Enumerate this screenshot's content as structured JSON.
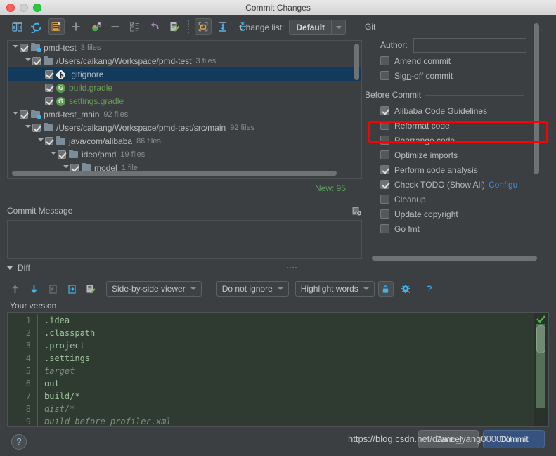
{
  "window": {
    "title": "Commit Changes"
  },
  "toolbar": {
    "icons": [
      {
        "name": "refresh-changes-icon"
      },
      {
        "name": "rollback-icon"
      },
      {
        "name": "delete-changelist-icon"
      },
      {
        "name": "add-icon"
      },
      {
        "name": "move-to-changelist-icon"
      },
      {
        "name": "minus-icon"
      },
      {
        "name": "select-all-icon"
      },
      {
        "name": "revert-icon"
      },
      {
        "name": "edit-source-icon"
      },
      {
        "name": "group-by-directory-icon"
      },
      {
        "name": "expand-all-icon"
      },
      {
        "name": "collapse-all-icon"
      }
    ],
    "changelist_label": "Change list:",
    "changelist_value": "Default"
  },
  "tree": {
    "rows": [
      {
        "indent": 0,
        "twisty": "open",
        "checked": true,
        "icon": "folder-modified-icon",
        "name": "pmd-test",
        "count": "3 files",
        "selected": false,
        "green": false
      },
      {
        "indent": 1,
        "twisty": "open",
        "checked": true,
        "icon": "folder-icon",
        "name": "/Users/caikang/Workspace/pmd-test",
        "count": "3 files",
        "selected": false,
        "green": false
      },
      {
        "indent": 2,
        "twisty": "none",
        "checked": true,
        "icon": "git-file-icon",
        "name": ".gitignore",
        "count": "",
        "selected": true,
        "green": false
      },
      {
        "indent": 2,
        "twisty": "none",
        "checked": true,
        "icon": "gradle-icon",
        "name": "build.gradle",
        "count": "",
        "selected": false,
        "green": true
      },
      {
        "indent": 2,
        "twisty": "none",
        "checked": true,
        "icon": "gradle-icon",
        "name": "settings.gradle",
        "count": "",
        "selected": false,
        "green": true
      },
      {
        "indent": 0,
        "twisty": "open",
        "checked": true,
        "icon": "folder-modified-icon",
        "name": "pmd-test_main",
        "count": "92 files",
        "selected": false,
        "green": false
      },
      {
        "indent": 1,
        "twisty": "open",
        "checked": true,
        "icon": "folder-icon",
        "name": "/Users/caikang/Workspace/pmd-test/src/main",
        "count": "92 files",
        "selected": false,
        "green": false
      },
      {
        "indent": 2,
        "twisty": "open",
        "checked": true,
        "icon": "folder-icon",
        "name": "java/com/alibaba",
        "count": "86 files",
        "selected": false,
        "green": false
      },
      {
        "indent": 3,
        "twisty": "open",
        "checked": true,
        "icon": "folder-icon",
        "name": "idea/pmd",
        "count": "19 files",
        "selected": false,
        "green": false
      },
      {
        "indent": 4,
        "twisty": "open",
        "checked": true,
        "icon": "folder-icon",
        "name": "model",
        "count": "1 file",
        "selected": false,
        "green": false
      }
    ],
    "new_count": "New: 95"
  },
  "commit_message": {
    "title": "Commit Message",
    "value": "",
    "history_icon": "commit-history-icon"
  },
  "git": {
    "section_title": "Git",
    "author_label": "Author:",
    "author_value": "",
    "options": [
      {
        "label": "Amend commit",
        "checked": false,
        "mnemonic_index": 1
      },
      {
        "label": "Sign-off commit",
        "checked": false,
        "mnemonic_index": 3
      }
    ]
  },
  "before_commit": {
    "section_title": "Before Commit",
    "options": [
      {
        "label": "Alibaba Code Guidelines",
        "checked": true,
        "highlighted": true
      },
      {
        "label": "Reformat code",
        "checked": false,
        "highlighted": false
      },
      {
        "label": "Rearrange code",
        "checked": false,
        "highlighted": false
      },
      {
        "label": "Optimize imports",
        "checked": false,
        "highlighted": false
      },
      {
        "label": "Perform code analysis",
        "checked": true,
        "highlighted": false
      },
      {
        "label": "Check TODO (Show All)",
        "checked": true,
        "highlighted": false,
        "link": "Configu"
      },
      {
        "label": "Cleanup",
        "checked": false,
        "highlighted": false
      },
      {
        "label": "Update copyright",
        "checked": false,
        "highlighted": false
      },
      {
        "label": "Go fmt",
        "checked": false,
        "highlighted": false
      }
    ],
    "highlight_color": "#ff0000"
  },
  "diff": {
    "section_title": "Diff",
    "toolbar_icons": [
      {
        "name": "previous-difference-icon"
      },
      {
        "name": "next-difference-icon"
      },
      {
        "name": "revert-change-icon"
      },
      {
        "name": "apply-change-icon"
      },
      {
        "name": "edit-source-icon"
      }
    ],
    "viewer_mode": "Side-by-side viewer",
    "ignore_mode": "Do not ignore",
    "highlight_mode": "Highlight words",
    "lock_icon": "lock-icon",
    "settings_icon": "gear-icon",
    "help_icon": "question-mark-icon",
    "pane_title": "Your version",
    "lines": [
      {
        "num": "1",
        "text": ".idea",
        "dim": false
      },
      {
        "num": "2",
        "text": ".classpath",
        "dim": false
      },
      {
        "num": "3",
        "text": ".project",
        "dim": false
      },
      {
        "num": "4",
        "text": ".settings",
        "dim": false
      },
      {
        "num": "5",
        "text": "target",
        "dim": true
      },
      {
        "num": "6",
        "text": "out",
        "dim": false
      },
      {
        "num": "7",
        "text": "build/*",
        "dim": false
      },
      {
        "num": "8",
        "text": "dist/*",
        "dim": true
      },
      {
        "num": "9",
        "text": "build-before-profiler.xml",
        "dim": true
      }
    ]
  },
  "footer": {
    "help_label": "?",
    "cancel_label": "Cancel",
    "commit_label": "Commit",
    "watermark": "https://blog.csdn.net/dawei_yang000000"
  }
}
